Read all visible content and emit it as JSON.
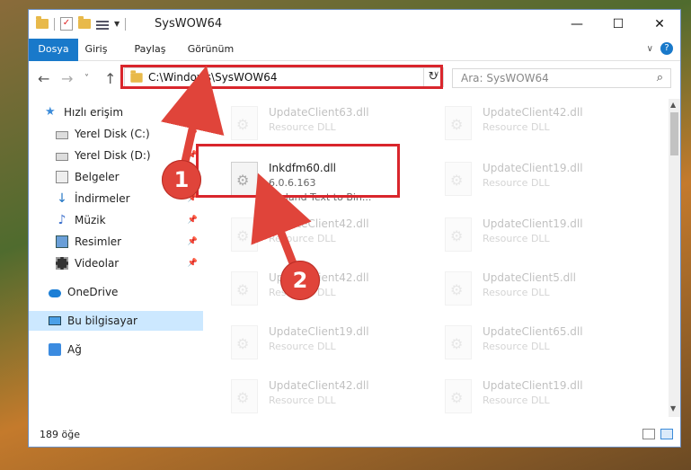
{
  "window": {
    "title": "SysWOW64",
    "controls": {
      "minimize": "—",
      "maximize": "☐",
      "close": "✕"
    }
  },
  "ribbon": {
    "tabs": [
      "Dosya",
      "Giriş",
      "Paylaş",
      "Görünüm"
    ],
    "help": "?"
  },
  "nav": {
    "back": "←",
    "forward": "→",
    "recent": "˅",
    "up": "↑",
    "address": "C:\\Windows\\SysWOW64",
    "refresh": "↻",
    "search_placeholder": "Ara: SysWOW64",
    "search_icon": "⌕"
  },
  "sidebar": {
    "items": [
      {
        "label": "Hızlı erişim",
        "icon": "star-icon"
      },
      {
        "label": "Yerel Disk (C:)",
        "icon": "disk-icon",
        "pinned": true
      },
      {
        "label": "Yerel Disk (D:)",
        "icon": "disk-icon",
        "pinned": true
      },
      {
        "label": "Belgeler",
        "icon": "documents-icon",
        "pinned": true
      },
      {
        "label": "İndirmeler",
        "icon": "downloads-icon",
        "pinned": true
      },
      {
        "label": "Müzik",
        "icon": "music-icon",
        "pinned": true
      },
      {
        "label": "Resimler",
        "icon": "pictures-icon",
        "pinned": true
      },
      {
        "label": "Videolar",
        "icon": "videos-icon",
        "pinned": true
      },
      {
        "label": "OneDrive",
        "icon": "cloud-icon"
      },
      {
        "label": "Bu bilgisayar",
        "icon": "computer-icon",
        "selected": true
      },
      {
        "label": "Ağ",
        "icon": "network-icon"
      }
    ]
  },
  "files": {
    "left": [
      {
        "name": "UpdateClient63.dll",
        "line2": "Resource DLL"
      },
      {
        "name": "Inkdfm60.dll",
        "line2": "6.0.6.163",
        "line3": "Borland Text to Bin...",
        "highlighted": true
      },
      {
        "name": "UpdateClient42.dll",
        "line2": "Resource DLL"
      },
      {
        "name": "UpdateClient42.dll",
        "line2": "Resource DLL"
      },
      {
        "name": "UpdateClient19.dll",
        "line2": "Resource DLL"
      },
      {
        "name": "UpdateClient42.dll",
        "line2": "Resource DLL"
      }
    ],
    "right": [
      {
        "name": "UpdateClient42.dll",
        "line2": "Resource DLL"
      },
      {
        "name": "UpdateClient19.dll",
        "line2": "Resource DLL"
      },
      {
        "name": "UpdateClient19.dll",
        "line2": "Resource DLL"
      },
      {
        "name": "UpdateClient5.dll",
        "line2": "Resource DLL"
      },
      {
        "name": "UpdateClient65.dll",
        "line2": "Resource DLL"
      },
      {
        "name": "UpdateClient19.dll",
        "line2": "Resource DLL"
      }
    ]
  },
  "status": {
    "item_count": "189 öğe"
  },
  "callouts": [
    {
      "number": "1"
    },
    {
      "number": "2"
    }
  ],
  "colors": {
    "accent": "#1979ca",
    "highlight": "#d9262c",
    "callout": "#e0443a"
  }
}
